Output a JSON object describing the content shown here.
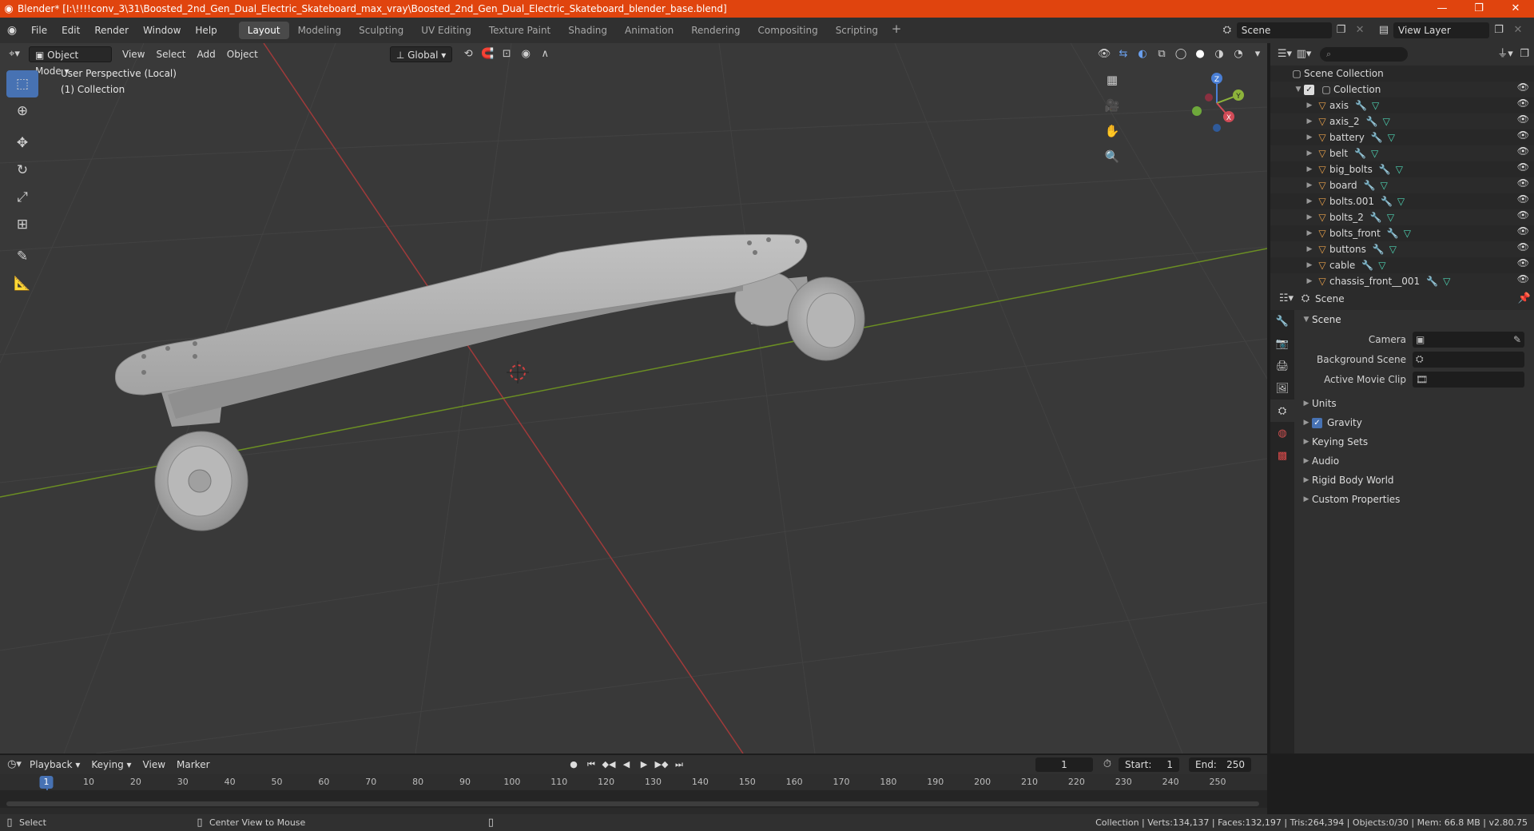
{
  "window": {
    "title": "Blender* [I:\\!!!!conv_3\\31\\Boosted_2nd_Gen_Dual_Electric_Skateboard_max_vray\\Boosted_2nd_Gen_Dual_Electric_Skateboard_blender_base.blend]",
    "controls": [
      "—",
      "❐",
      "✕"
    ]
  },
  "menu": {
    "items": [
      "File",
      "Edit",
      "Render",
      "Window",
      "Help"
    ],
    "workspaces": [
      "Layout",
      "Modeling",
      "Sculpting",
      "UV Editing",
      "Texture Paint",
      "Shading",
      "Animation",
      "Rendering",
      "Compositing",
      "Scripting"
    ],
    "active_workspace": "Layout",
    "scene": "Scene",
    "view_layer": "View Layer"
  },
  "viewport": {
    "mode": "Object Mode",
    "menus": [
      "View",
      "Select",
      "Add",
      "Object"
    ],
    "orientation": "Global",
    "overlay_line1": "User Perspective (Local)",
    "overlay_line2": "(1) Collection",
    "gizmo_axes": [
      "X",
      "Y",
      "Z"
    ],
    "colors": {
      "background": "#393939",
      "grid": "#424242",
      "x_axis": "#a03a3a",
      "y_axis": "#6b8e23",
      "model": "#b5b5b5",
      "active": "#4772b3"
    }
  },
  "outliner": {
    "search_placeholder": "",
    "scene_collection": "Scene Collection",
    "collection": "Collection",
    "objects": [
      "axis",
      "axis_2",
      "battery",
      "belt",
      "big_bolts",
      "board",
      "bolts.001",
      "bolts_2",
      "bolts_front",
      "buttons",
      "cable",
      "chassis_front__001"
    ]
  },
  "properties": {
    "header": "Scene",
    "panel": "Scene",
    "rows": [
      {
        "label": "Camera",
        "value": ""
      },
      {
        "label": "Background Scene",
        "value": ""
      },
      {
        "label": "Active Movie Clip",
        "value": ""
      }
    ],
    "subpanels": [
      "Units",
      "Gravity",
      "Keying Sets",
      "Audio",
      "Rigid Body World",
      "Custom Properties"
    ],
    "gravity_checked": true
  },
  "timeline": {
    "menus": [
      "Playback",
      "Keying",
      "View",
      "Marker"
    ],
    "current_frame": "1",
    "start_label": "Start:",
    "start": "1",
    "end_label": "End:",
    "end": "250",
    "ticks": [
      "1",
      "10",
      "20",
      "30",
      "40",
      "50",
      "60",
      "70",
      "80",
      "90",
      "100",
      "110",
      "120",
      "130",
      "140",
      "150",
      "160",
      "170",
      "180",
      "190",
      "200",
      "210",
      "220",
      "230",
      "240",
      "250"
    ]
  },
  "status": {
    "left": "Select",
    "middle": "Center View to Mouse",
    "right": "Collection | Verts:134,137 | Faces:132,197 | Tris:264,394 | Objects:0/30 | Mem: 66.8 MB | v2.80.75"
  }
}
